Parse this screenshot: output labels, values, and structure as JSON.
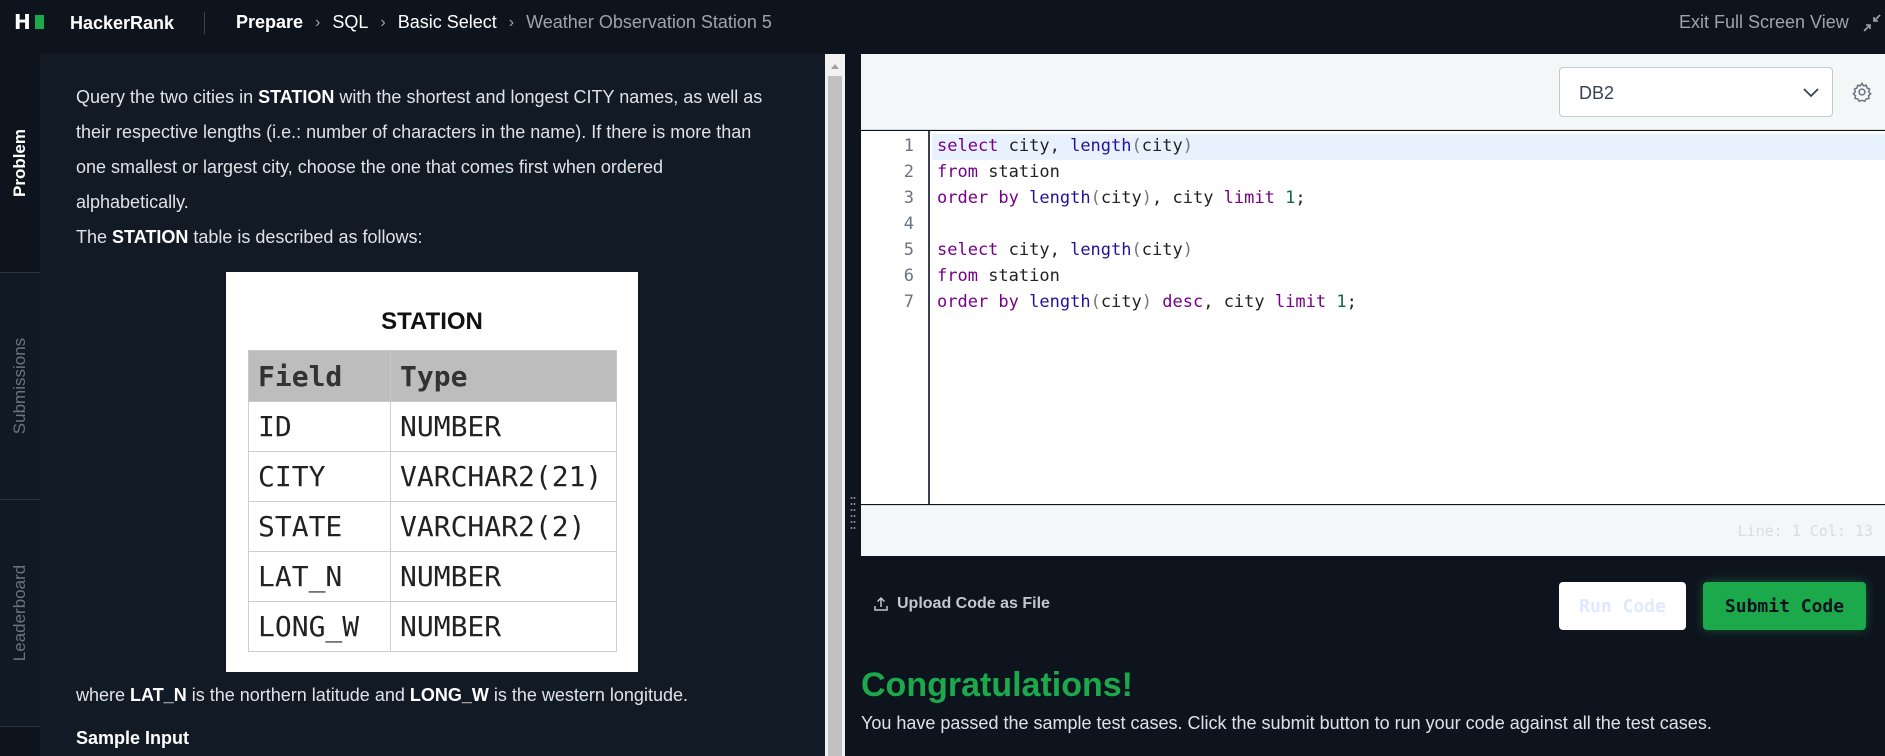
{
  "header": {
    "logo_letter": "H",
    "brand": "HackerRank",
    "breadcrumbs": [
      "Prepare",
      "SQL",
      "Basic Select",
      "Weather Observation Station 5"
    ],
    "exit_fullscreen": "Exit Full Screen View"
  },
  "side_tabs": [
    "Problem",
    "Submissions",
    "Leaderboard"
  ],
  "problem": {
    "para1_pre": "Query the two cities in ",
    "para1_station": "STATION",
    "para1_post": " with the shortest and longest CITY names, as well as their respective lengths (i.e.: number of characters in the name). If there is more than one smallest or largest city, choose the one that comes first when ordered alphabetically.",
    "para2_pre": "The ",
    "para2_station": "STATION",
    "para2_post": " table is described as follows:",
    "table": {
      "title": "STATION",
      "headers": [
        "Field",
        "Type"
      ],
      "rows": [
        [
          "ID",
          "NUMBER"
        ],
        [
          "CITY",
          "VARCHAR2(21)"
        ],
        [
          "STATE",
          "VARCHAR2(2)"
        ],
        [
          "LAT_N",
          "NUMBER"
        ],
        [
          "LONG_W",
          "NUMBER"
        ]
      ]
    },
    "where_pre": "where ",
    "where_latn": "LAT_N",
    "where_mid": " is the northern latitude and ",
    "where_longw": "LONG_W",
    "where_post": " is the western longitude.",
    "sample_input": "Sample Input"
  },
  "editor": {
    "language": "DB2",
    "line_numbers": [
      "1",
      "2",
      "3",
      "4",
      "5",
      "6",
      "7"
    ],
    "status": "Line: 1 Col: 13",
    "code": {
      "l1": {
        "kw1": "select",
        "t1": " city, ",
        "fn1": "length",
        "p1": "(",
        "t2": "city",
        "p2": ")"
      },
      "l2": {
        "kw1": "from",
        "t1": " station"
      },
      "l3": {
        "kw1": "order by",
        "t0": " ",
        "fn1": "length",
        "p1": "(",
        "t1": "city",
        "p2": ")",
        "t2": ", city ",
        "kw2": "limit",
        "t3": " ",
        "n1": "1",
        "t4": ";"
      },
      "l5": {
        "kw1": "select",
        "t1": " city, ",
        "fn1": "length",
        "p1": "(",
        "t2": "city",
        "p2": ")"
      },
      "l6": {
        "kw1": "from",
        "t1": " station"
      },
      "l7": {
        "kw1": "order by",
        "t0": " ",
        "fn1": "length",
        "p1": "(",
        "t1": "city",
        "p2": ")",
        "t2": " ",
        "kw3": "desc",
        "t5": ", city ",
        "kw2": "limit",
        "t3": " ",
        "n1": "1",
        "t4": ";"
      }
    }
  },
  "actions": {
    "upload": "Upload Code as File",
    "run": "Run Code",
    "submit": "Submit Code"
  },
  "result": {
    "title": "Congratulations!",
    "message": "You have passed the sample test cases. Click the submit button to run your code against all the test cases."
  },
  "colors": {
    "accent_green": "#1ba94c",
    "background": "#0e141e"
  }
}
